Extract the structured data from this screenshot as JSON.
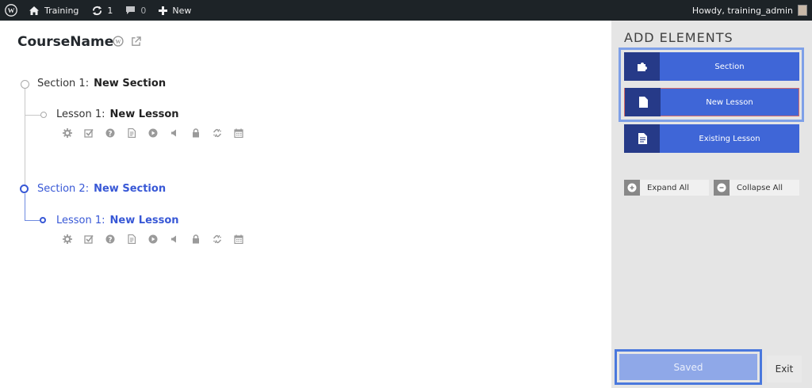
{
  "adminbar": {
    "site_name": "Training",
    "updates_count": "1",
    "comments_count": "0",
    "new_label": "New",
    "howdy": "Howdy, training_admin"
  },
  "course": {
    "title": "CourseName"
  },
  "tree": {
    "sections": [
      {
        "prefix": "Section 1:",
        "name": "New Section",
        "lessons": [
          {
            "prefix": "Lesson 1:",
            "name": "New Lesson"
          }
        ]
      },
      {
        "prefix": "Section 2:",
        "name": "New Section",
        "lessons": [
          {
            "prefix": "Lesson 1:",
            "name": "New Lesson"
          }
        ]
      }
    ],
    "lesson_actions": [
      "gear-icon",
      "checkbox-icon",
      "question-icon",
      "document-icon",
      "play-icon",
      "audio-icon",
      "lock-icon",
      "unlink-icon",
      "calendar-icon"
    ]
  },
  "sidebar": {
    "title": "ADD ELEMENTS",
    "buttons": {
      "section": "Section",
      "new_lesson": "New Lesson",
      "existing_lesson": "Existing Lesson"
    },
    "expand_all": "Expand All",
    "collapse_all": "Collapse All",
    "saved": "Saved",
    "exit": "Exit"
  },
  "colors": {
    "accent": "#3f66d7",
    "accent_dark": "#263a88",
    "active_text": "#3858d6",
    "adminbar_bg": "#1d2327",
    "sidebar_bg": "#e5e5e5"
  }
}
